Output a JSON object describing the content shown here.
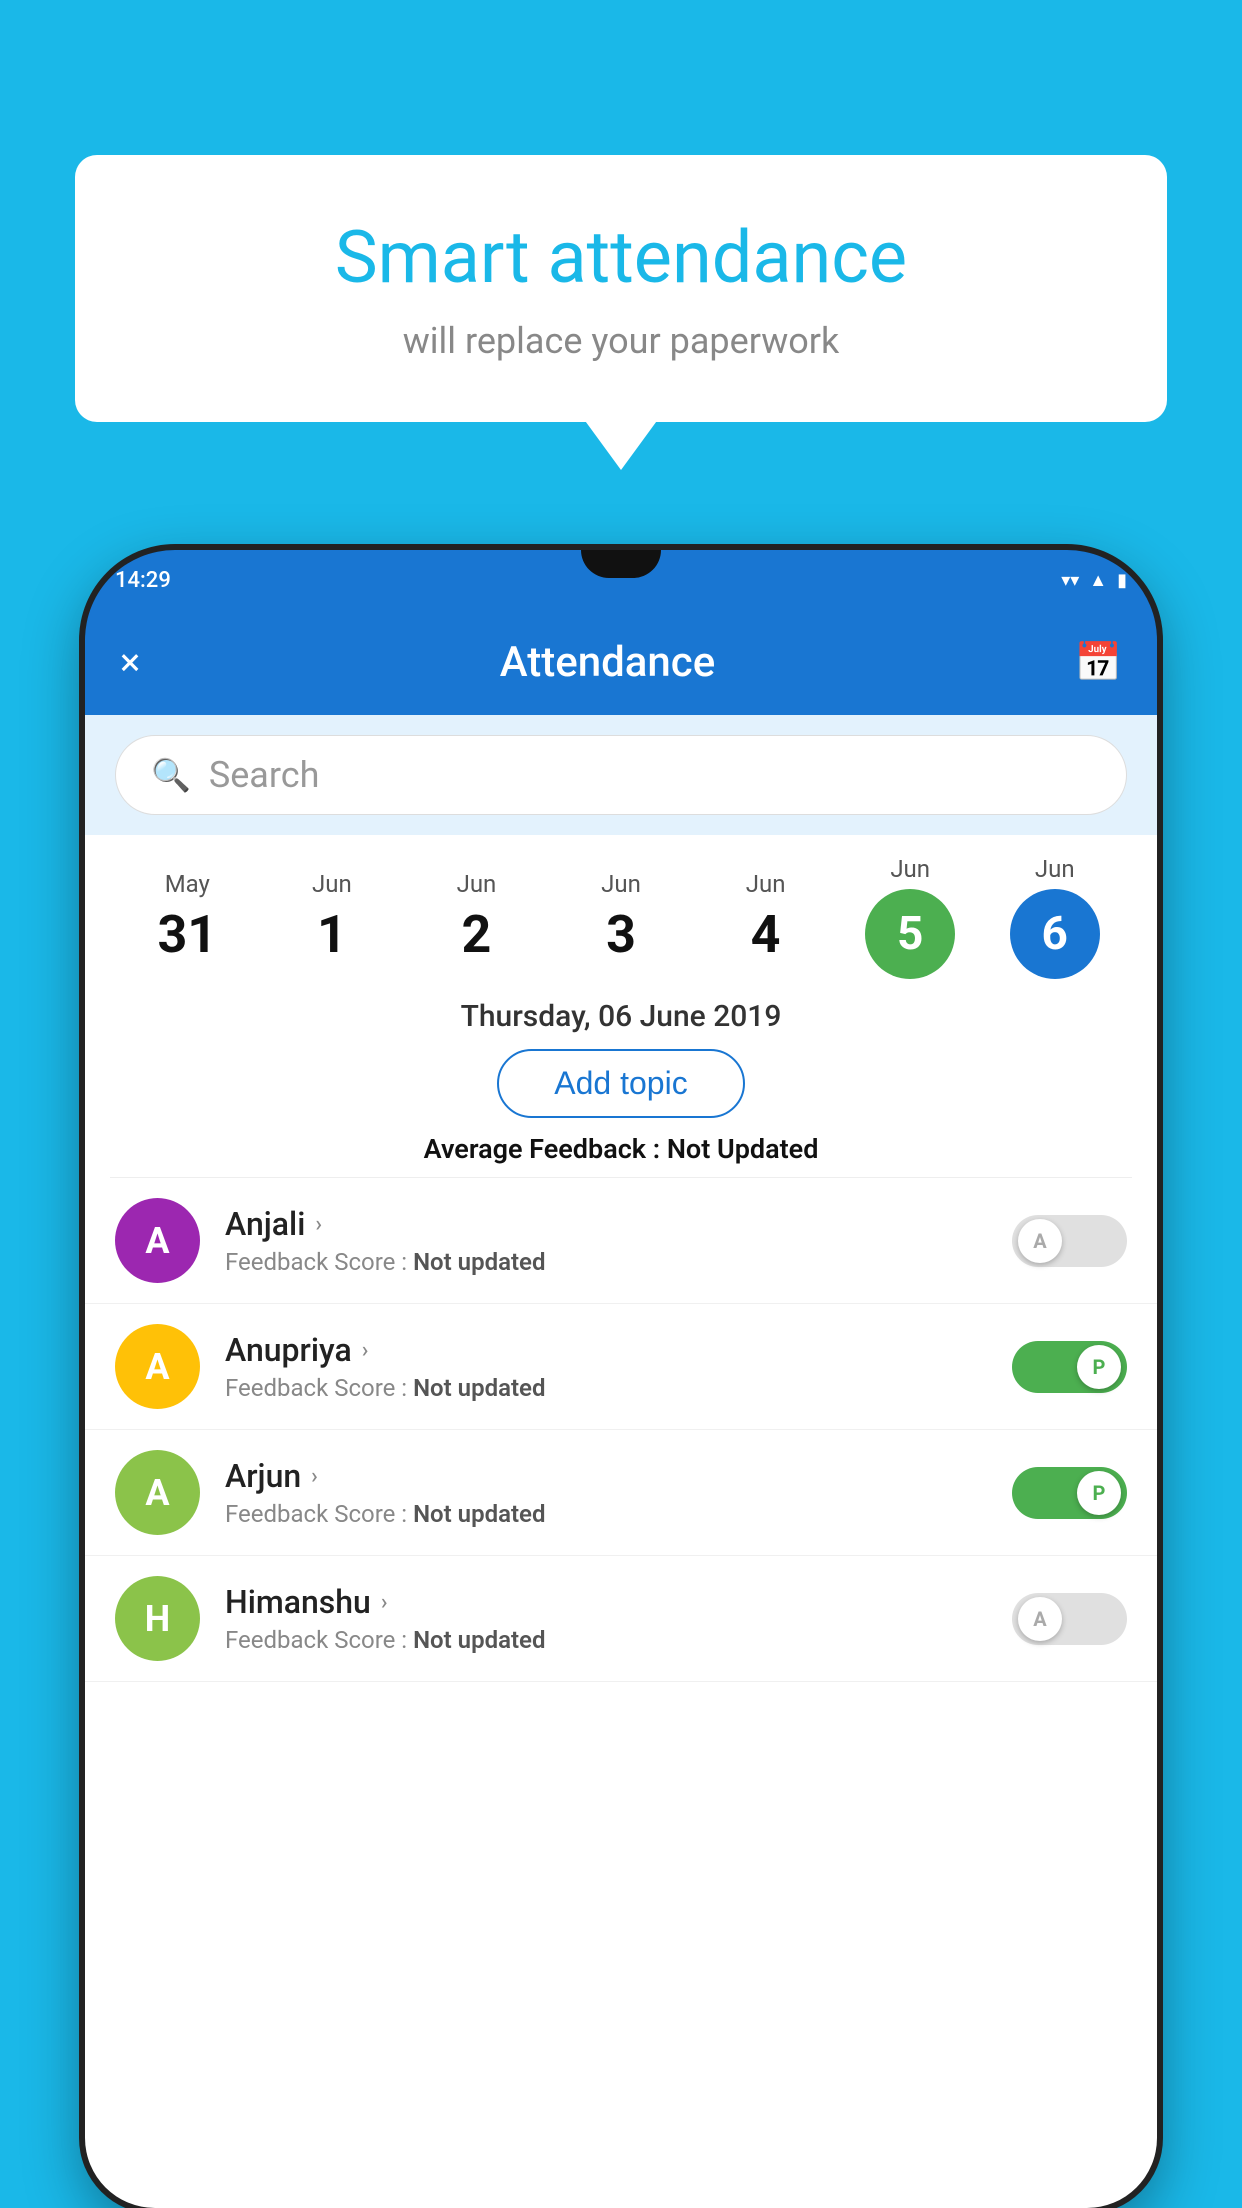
{
  "background_color": "#1ab8e8",
  "bubble": {
    "title": "Smart attendance",
    "subtitle": "will replace your paperwork"
  },
  "phone": {
    "status_time": "14:29",
    "app_bar": {
      "title": "Attendance",
      "close_label": "×",
      "calendar_icon": "📅"
    },
    "search": {
      "placeholder": "Search"
    },
    "date_strip": {
      "columns": [
        {
          "month": "May",
          "day": "31",
          "selected": false
        },
        {
          "month": "Jun",
          "day": "1",
          "selected": false
        },
        {
          "month": "Jun",
          "day": "2",
          "selected": false
        },
        {
          "month": "Jun",
          "day": "3",
          "selected": false
        },
        {
          "month": "Jun",
          "day": "4",
          "selected": false
        },
        {
          "month": "Jun",
          "day": "5",
          "selected": "green"
        },
        {
          "month": "Jun",
          "day": "6",
          "selected": "blue"
        }
      ]
    },
    "selected_date_label": "Thursday, 06 June 2019",
    "add_topic_label": "Add topic",
    "avg_feedback_prefix": "Average Feedback : ",
    "avg_feedback_value": "Not Updated",
    "students": [
      {
        "name": "Anjali",
        "initial": "A",
        "avatar_color": "purple",
        "feedback_label": "Feedback Score : ",
        "feedback_value": "Not updated",
        "toggle_state": "off",
        "toggle_label": "A"
      },
      {
        "name": "Anupriya",
        "initial": "A",
        "avatar_color": "yellow",
        "feedback_label": "Feedback Score : ",
        "feedback_value": "Not updated",
        "toggle_state": "on",
        "toggle_label": "P"
      },
      {
        "name": "Arjun",
        "initial": "A",
        "avatar_color": "green",
        "feedback_label": "Feedback Score : ",
        "feedback_value": "Not updated",
        "toggle_state": "on",
        "toggle_label": "P"
      },
      {
        "name": "Himanshu",
        "initial": "H",
        "avatar_color": "olive",
        "feedback_label": "Feedback Score : ",
        "feedback_value": "Not updated",
        "toggle_state": "off",
        "toggle_label": "A"
      }
    ]
  }
}
